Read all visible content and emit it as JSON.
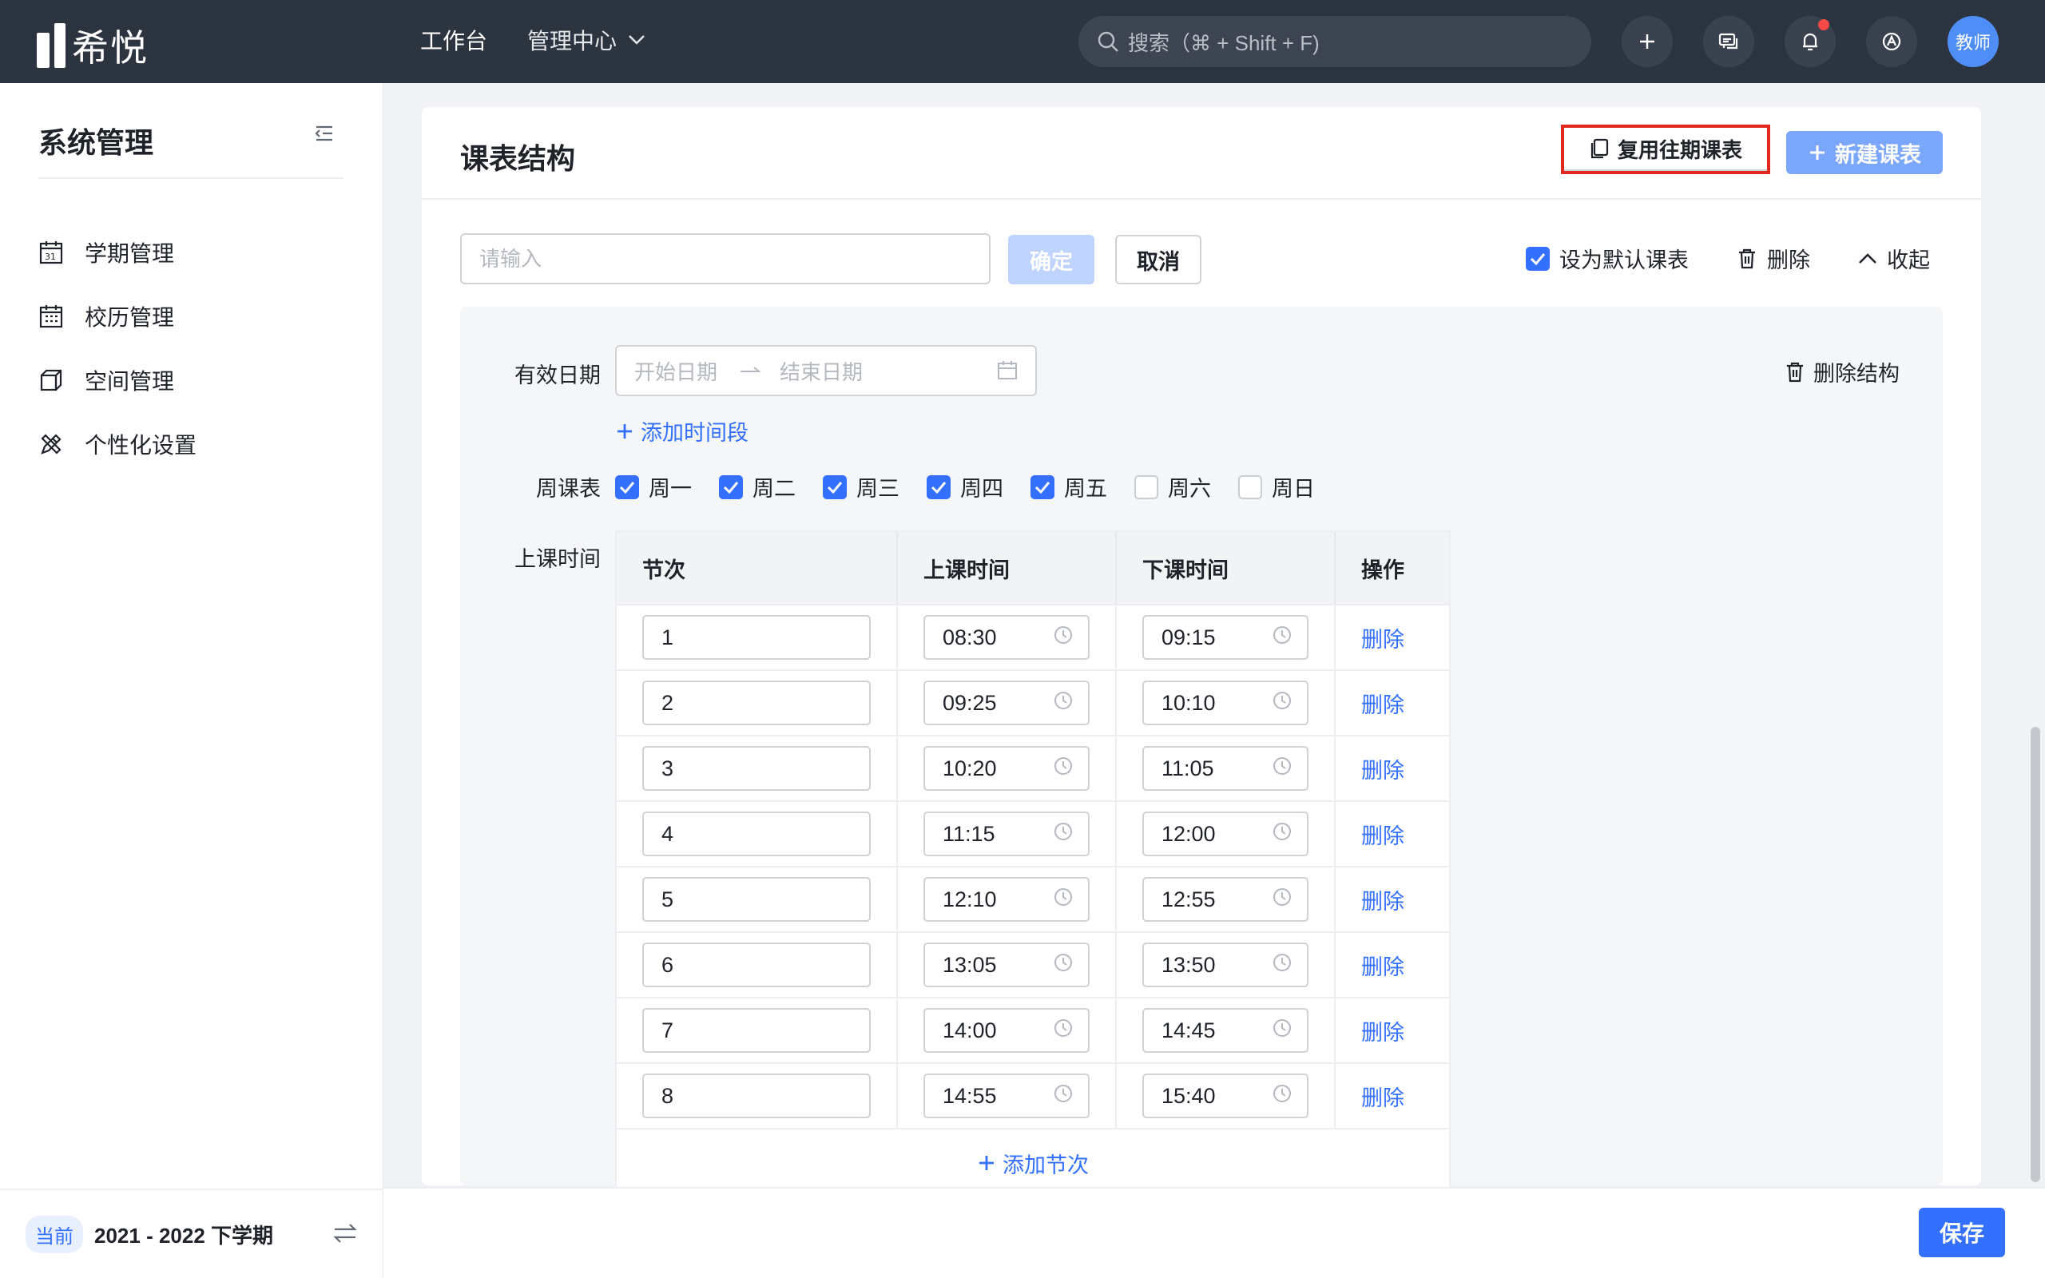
{
  "app": {
    "name": "希悦"
  },
  "topnav": {
    "items": [
      {
        "label": "工作台"
      },
      {
        "label": "管理中心"
      }
    ],
    "search_placeholder": "搜索（⌘ + Shift + F)",
    "avatar_label": "教师"
  },
  "sidebar": {
    "title": "系统管理",
    "items": [
      {
        "label": "学期管理",
        "icon": "calendar-31-icon"
      },
      {
        "label": "校历管理",
        "icon": "calendar-grid-icon"
      },
      {
        "label": "空间管理",
        "icon": "cube-icon"
      },
      {
        "label": "个性化设置",
        "icon": "pencil-ruler-icon"
      }
    ],
    "footer": {
      "badge": "当前",
      "term": "2021 - 2022 下学期"
    }
  },
  "card": {
    "title": "课表结构",
    "reuse_button": "复用往期课表",
    "new_button": "新建课表",
    "name_input_placeholder": "请输入",
    "ok_button": "确定",
    "cancel_button": "取消",
    "default_checkbox_label": "设为默认课表",
    "default_checked": true,
    "delete_label": "删除",
    "collapse_label": "收起"
  },
  "structure": {
    "valid_date_label": "有效日期",
    "start_placeholder": "开始日期",
    "end_placeholder": "结束日期",
    "delete_structure": "删除结构",
    "add_period": "添加时间段",
    "week_label": "周课表",
    "weekdays": [
      {
        "label": "周一",
        "checked": true
      },
      {
        "label": "周二",
        "checked": true
      },
      {
        "label": "周三",
        "checked": true
      },
      {
        "label": "周四",
        "checked": true
      },
      {
        "label": "周五",
        "checked": true
      },
      {
        "label": "周六",
        "checked": false
      },
      {
        "label": "周日",
        "checked": false
      }
    ],
    "class_time_label": "上课时间",
    "table": {
      "headers": [
        "节次",
        "上课时间",
        "下课时间",
        "操作"
      ],
      "rows": [
        {
          "period": "1",
          "start": "08:30",
          "end": "09:15",
          "action": "删除"
        },
        {
          "period": "2",
          "start": "09:25",
          "end": "10:10",
          "action": "删除"
        },
        {
          "period": "3",
          "start": "10:20",
          "end": "11:05",
          "action": "删除"
        },
        {
          "period": "4",
          "start": "11:15",
          "end": "12:00",
          "action": "删除"
        },
        {
          "period": "5",
          "start": "12:10",
          "end": "12:55",
          "action": "删除"
        },
        {
          "period": "6",
          "start": "13:05",
          "end": "13:50",
          "action": "删除"
        },
        {
          "period": "7",
          "start": "14:00",
          "end": "14:45",
          "action": "删除"
        },
        {
          "period": "8",
          "start": "14:55",
          "end": "15:40",
          "action": "删除"
        }
      ],
      "add_row": "添加节次"
    }
  },
  "footer": {
    "save_button": "保存"
  },
  "colors": {
    "topbar": "#2c3440",
    "accent": "#3370ff",
    "highlight": "#e0281e"
  }
}
